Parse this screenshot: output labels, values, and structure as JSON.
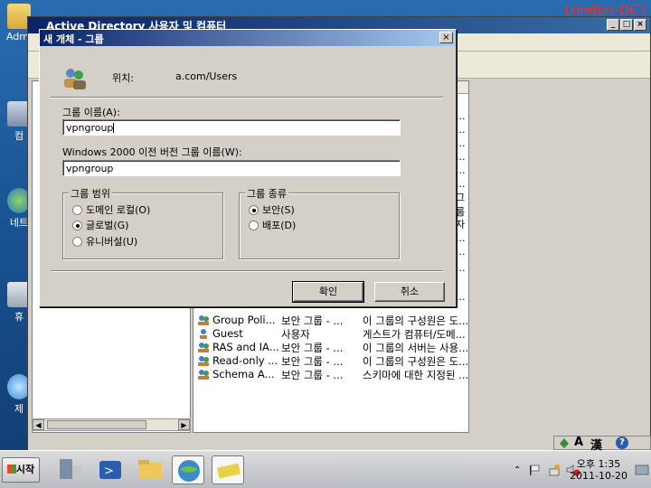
{
  "machine_name": "London-DC1",
  "desktop_icons": [
    {
      "label": "Admi",
      "icon": "folder-icon"
    },
    {
      "label": "컴",
      "icon": "computer-icon"
    },
    {
      "label": "네트",
      "icon": "network-icon"
    },
    {
      "label": "휴",
      "icon": "recycle-bin-icon"
    },
    {
      "label": "제",
      "icon": "control-panel-icon"
    }
  ],
  "background_window": {
    "title": "Active Directory 사용자 및 컴퓨터",
    "list_rows": [
      {
        "name": "Group Poli...",
        "type": "보안 그룹 - ...",
        "desc": "이 그룹의 구성원은 도..."
      },
      {
        "name": "Guest",
        "type": "사용자",
        "desc": "게스트가 컴퓨터/도메..."
      },
      {
        "name": "RAS and IA...",
        "type": "보안 그룹 - ...",
        "desc": "이 그룹의 서버는 사용..."
      },
      {
        "name": "Read-only ...",
        "type": "보안 그룹 - ...",
        "desc": "이 그룹의 구성원은 도..."
      },
      {
        "name": "Schema A...",
        "type": "보안 그룹 - ...",
        "desc": "스키마에 대한 지정된 ..."
      }
    ],
    "partial_right": [
      "...",
      "...",
      "...",
      "...",
      "...",
      "...",
      "그룹",
      "자",
      "...",
      "...",
      "...",
      "..."
    ]
  },
  "dialog": {
    "title": "새 개체 - 그룹",
    "close_label": "×",
    "location_label": "위치:",
    "location_value": "a.com/Users",
    "group_name_label": "그룹 이름(A):",
    "group_name_value": "vpngroup",
    "pre2000_label": "Windows 2000 이전 버전 그룹 이름(W):",
    "pre2000_value": "vpngroup",
    "scope": {
      "title": "그룹 범위",
      "options": [
        "도메인 로컬(O)",
        "글로벌(G)",
        "유니버설(U)"
      ],
      "selected": 1
    },
    "type": {
      "title": "그룹 종류",
      "options": [
        "보안(S)",
        "배포(D)"
      ],
      "selected": 0
    },
    "ok_label": "확인",
    "cancel_label": "취소"
  },
  "taskbar": {
    "start_label": "시작",
    "clock_period": "오후 1:35",
    "clock_date": "2011-10-20"
  },
  "lang_bar": {
    "mode": "A",
    "hanja": "漢",
    "help": "?"
  }
}
